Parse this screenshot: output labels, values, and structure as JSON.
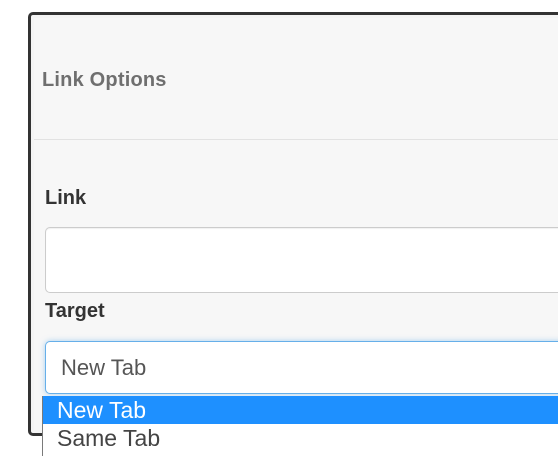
{
  "dialog": {
    "title": "Link Options"
  },
  "form": {
    "link": {
      "label": "Link",
      "value": ""
    },
    "target": {
      "label": "Target",
      "selected": "New Tab",
      "options": [
        {
          "label": "New Tab",
          "highlighted": true
        },
        {
          "label": "Same Tab",
          "highlighted": false
        }
      ]
    }
  },
  "colors": {
    "highlight": "#1e90ff",
    "focus_border": "#66afe9",
    "title_text": "#6f6f6f",
    "label_text": "#333333"
  }
}
